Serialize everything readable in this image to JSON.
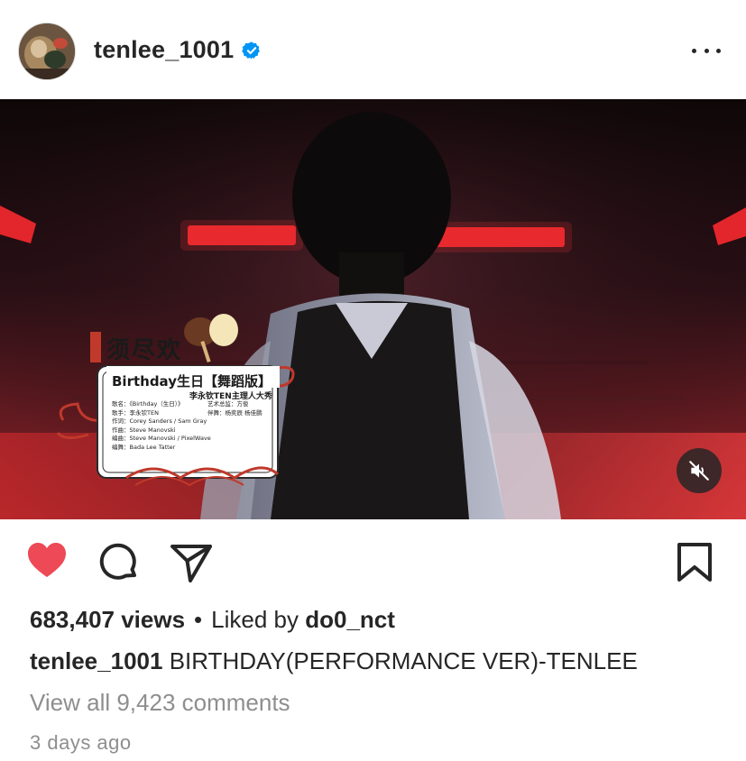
{
  "header": {
    "username": "tenlee_1001",
    "verified": true
  },
  "video": {
    "overlay_logo": "须尽欢",
    "overlay_card_title": "Birthday生日【舞蹈版】",
    "overlay_card_subtitle": "李永钦TEN主理人大秀",
    "overlay_credits": [
      "歌名：《Birthday（生日）》",
      "歌手：李永钦TEN",
      "作词：Corey Sanders / Sam Gray",
      "作曲：Steve Manovski",
      "编曲：Steve Manovski / PixelWave",
      "编舞：Bada Lee  Tatter"
    ],
    "overlay_credits_right": [
      "艺术总监：方俊",
      "伴舞：杨奕辰 杨佳鹏"
    ],
    "muted": true
  },
  "actions": {
    "liked": true,
    "like_color": "#ed4956"
  },
  "stats": {
    "views": "683,407 views",
    "separator": "•",
    "liked_by_prefix": "Liked by",
    "liked_by_user": "do0_nct"
  },
  "caption": {
    "username": "tenlee_1001",
    "text": "BIRTHDAY(PERFORMANCE VER)-TENLEE"
  },
  "comments_link": "View all 9,423 comments",
  "timestamp": "3 days ago",
  "colors": {
    "verified": "#0095f6",
    "secondary_text": "#8e8e8e",
    "accent_red": "#e3262b"
  }
}
